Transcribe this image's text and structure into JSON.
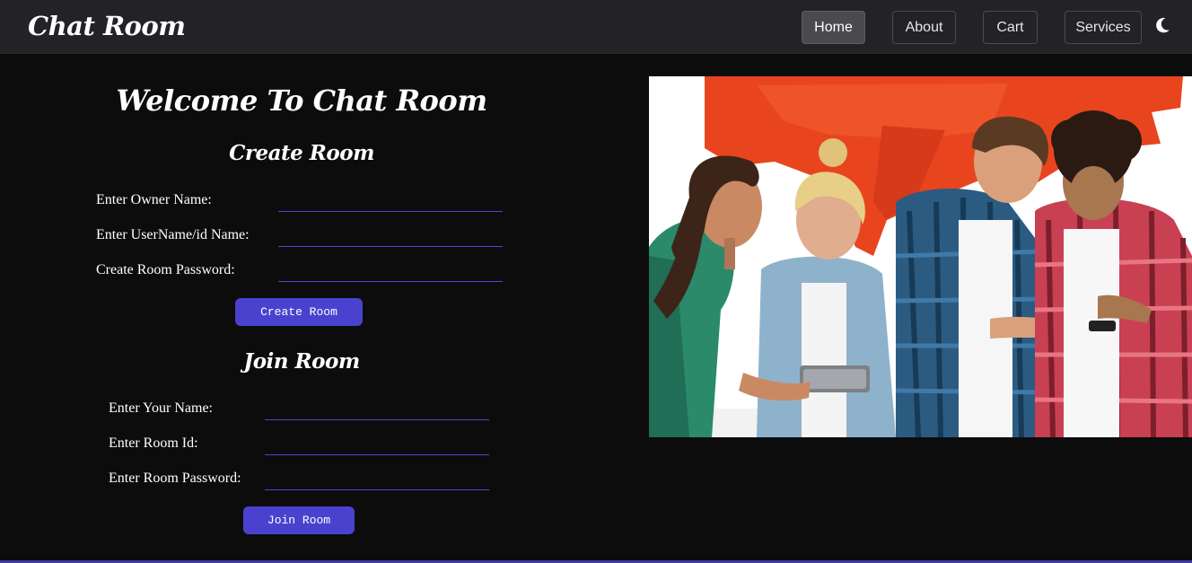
{
  "navbar": {
    "brand": "Chat Room",
    "items": [
      {
        "label": "Home",
        "active": true
      },
      {
        "label": "About",
        "active": false
      },
      {
        "label": "Cart",
        "active": false
      },
      {
        "label": "Services",
        "active": false
      }
    ],
    "theme_toggle_icon": "moon-icon"
  },
  "main": {
    "welcome": "Welcome To Chat Room",
    "create": {
      "title": "Create Room",
      "owner_label": "Enter Owner Name:",
      "username_label": "Enter UserName/id Name:",
      "password_label": "Create Room Password:",
      "owner_value": "",
      "username_value": "",
      "password_value": "",
      "button": "Create Room"
    },
    "join": {
      "title": "Join Room",
      "name_label": "Enter Your Name:",
      "roomid_label": "Enter Room Id:",
      "password_label": "Enter Room Password:",
      "name_value": "",
      "roomid_value": "",
      "password_value": "",
      "button": "Join Room"
    }
  },
  "hero_image": "people-using-phones-illustration",
  "colors": {
    "accent": "#4a42cf",
    "navbar_bg": "#232226",
    "page_bg": "#0c0c0d",
    "input_underline": "#4b47d1"
  }
}
